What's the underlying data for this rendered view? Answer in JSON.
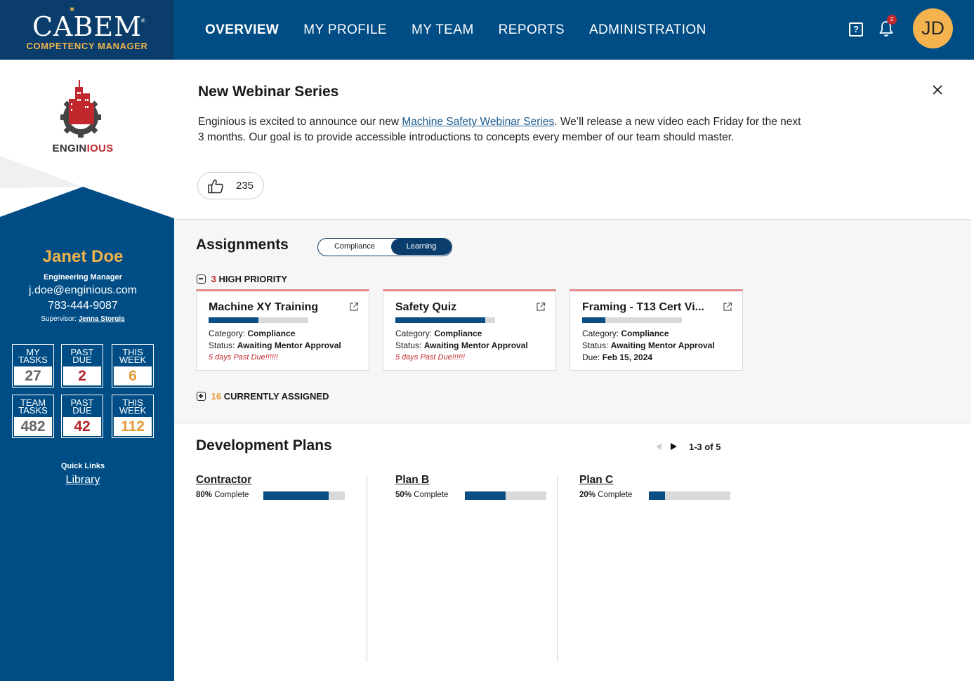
{
  "brand": {
    "name": "CABEM",
    "subtitle": "COMPETENCY MANAGER",
    "colors": {
      "navy": "#004d85",
      "gold": "#f0b44c",
      "red": "#c0282d"
    }
  },
  "nav": {
    "items": [
      {
        "label": "OVERVIEW",
        "active": true
      },
      {
        "label": "MY PROFILE",
        "active": false
      },
      {
        "label": "MY TEAM",
        "active": false
      },
      {
        "label": "REPORTS",
        "active": false
      },
      {
        "label": "ADMINISTRATION",
        "active": false
      }
    ],
    "notification_count": "2",
    "avatar_initials": "JD"
  },
  "sidebar": {
    "company": {
      "prefix": "ENGIN",
      "suffix": "IOUS"
    },
    "user": {
      "name": "Janet Doe",
      "title": "Engineering Manager",
      "email": "j.doe@enginious.com",
      "phone": "783-444-9087",
      "supervisor_label": "Supervisor:",
      "supervisor_name": "Jenna Storgis"
    },
    "stats": [
      {
        "label": "MY TASKS",
        "value": "27",
        "color": "gray"
      },
      {
        "label": "PAST DUE",
        "value": "2",
        "color": "red"
      },
      {
        "label": "THIS WEEK",
        "value": "6",
        "color": "gold"
      },
      {
        "label": "TEAM TASKS",
        "value": "482",
        "color": "gray"
      },
      {
        "label": "PAST DUE",
        "value": "42",
        "color": "red"
      },
      {
        "label": "THIS WEEK",
        "value": "112",
        "color": "gold"
      }
    ],
    "quick_links": {
      "title": "Quick Links",
      "items": [
        "Library"
      ]
    }
  },
  "announcement": {
    "title": "New Webinar Series",
    "body_before": "Enginious is excited to announce our new ",
    "body_link": "Machine Safety Webinar Series",
    "body_after": ". We’ll release a new video each Friday for the next 3 months. Our goal is to provide accessible introductions to concepts every member of our team should master.",
    "likes": "235"
  },
  "assignments": {
    "title": "Assignments",
    "toggle": {
      "left": "Compliance",
      "right": "Learning",
      "selected": "Learning"
    },
    "high_priority": {
      "count": "3",
      "label": "HIGH PRIORITY"
    },
    "cards": [
      {
        "title": "Machine XY Training",
        "progress": 0.5,
        "category_label": "Category:",
        "category": "Compliance",
        "status_label": "Status:",
        "status": "Awaiting Mentor Approval",
        "due_label": "",
        "due": "5 days Past Due!!!!!!",
        "overdue": true
      },
      {
        "title": "Safety Quiz",
        "progress": 0.9,
        "category_label": "Category:",
        "category": "Compliance",
        "status_label": "Status:",
        "status": "Awaiting Mentor Approval",
        "due_label": "",
        "due": "5 days Past Due!!!!!!",
        "overdue": true
      },
      {
        "title": "Framing - T13 Cert Vi...",
        "progress": 0.23,
        "category_label": "Category:",
        "category": "Compliance",
        "status_label": "Status:",
        "status": "Awaiting Mentor Approval",
        "due_label": "Due:",
        "due": "Feb 15, 2024",
        "overdue": false
      }
    ],
    "currently_assigned": {
      "count": "16",
      "label": "CURRENTLY ASSIGNED"
    }
  },
  "development": {
    "title": "Development Plans",
    "pager": "1-3 of 5",
    "plans": [
      {
        "name": "Contractor",
        "percent": "80%",
        "fraction": 0.8,
        "complete_label": "Complete"
      },
      {
        "name": "Plan B",
        "percent": "50%",
        "fraction": 0.5,
        "complete_label": "Complete"
      },
      {
        "name": "Plan C",
        "percent": "20%",
        "fraction": 0.2,
        "complete_label": "Complete"
      }
    ]
  }
}
